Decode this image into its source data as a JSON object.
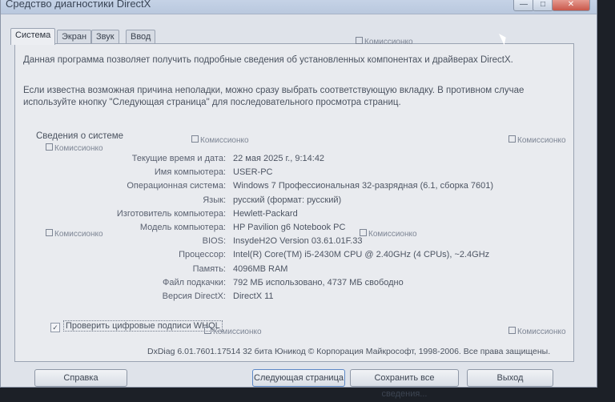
{
  "window": {
    "title": "Средство диагностики DirectX",
    "controls": {
      "minimize": "—",
      "maximize": "□",
      "close": "✕"
    }
  },
  "tabs": [
    {
      "label": "Система",
      "active": true
    },
    {
      "label": "Экран"
    },
    {
      "label": "Звук"
    },
    {
      "label": "Ввод"
    }
  ],
  "intro": {
    "line1": "Данная программа позволяет получить подробные сведения об установленных компонентах и драйверах DirectX.",
    "line2": "Если известна возможная причина неполадки, можно сразу выбрать соответствующую вкладку. В противном случае используйте кнопку \"Следующая страница\" для последовательного просмотра страниц."
  },
  "system_info": {
    "section_title": "Сведения о системе",
    "rows": [
      {
        "label": "Текущие время и дата:",
        "value": "22 мая 2025 г., 9:14:42"
      },
      {
        "label": "Имя компьютера:",
        "value": "USER-PC"
      },
      {
        "label": "Операционная система:",
        "value": "Windows 7 Профессиональная 32-разрядная (6.1, сборка 7601)"
      },
      {
        "label": "Язык:",
        "value": "русский (формат: русский)"
      },
      {
        "label": "Изготовитель компьютера:",
        "value": "Hewlett-Packard"
      },
      {
        "label": "Модель компьютера:",
        "value": "HP Pavilion g6 Notebook PC"
      },
      {
        "label": "BIOS:",
        "value": "InsydeH2O Version 03.61.01F.33"
      },
      {
        "label": "Процессор:",
        "value": "Intel(R) Core(TM) i5-2430M CPU @ 2.40GHz (4 CPUs), ~2.4GHz"
      },
      {
        "label": "Память:",
        "value": "4096MB RAM"
      },
      {
        "label": "Файл подкачки:",
        "value": "792 МБ использовано, 4737 МБ свободно"
      },
      {
        "label": "Версия DirectX:",
        "value": "DirectX 11"
      }
    ]
  },
  "whql_checkbox": {
    "label": "Проверить цифровые подписи WHQL",
    "checked": true,
    "mark": "✓"
  },
  "footer": "DxDiag 6.01.7601.17514 32 бита Юникод  © Корпорация Майкрософт, 1998-2006. Все права защищены.",
  "buttons": {
    "help": "Справка",
    "next_page": "Следующая страница",
    "save_all": "Сохранить все сведения...",
    "exit": "Выход"
  },
  "watermark": {
    "text": "Комиссионко"
  }
}
